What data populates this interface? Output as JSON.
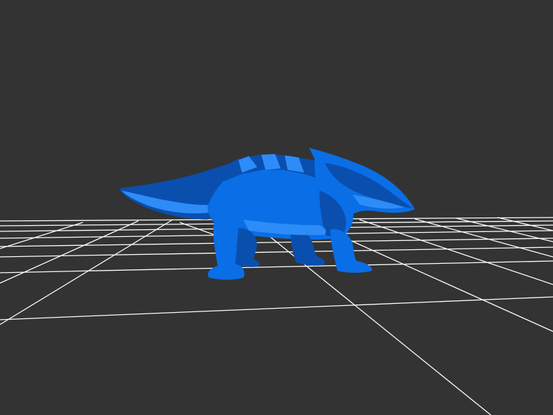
{
  "viewer": {
    "background_color": "#333333",
    "grid_color": "#ffffff",
    "grid_visible": true,
    "model_color": "#0a6ee6",
    "model_shade_dark": "#0a4fae",
    "model_shade_light": "#2d8cf8",
    "model_subject": "quadruped-armored-lizard-creature"
  }
}
